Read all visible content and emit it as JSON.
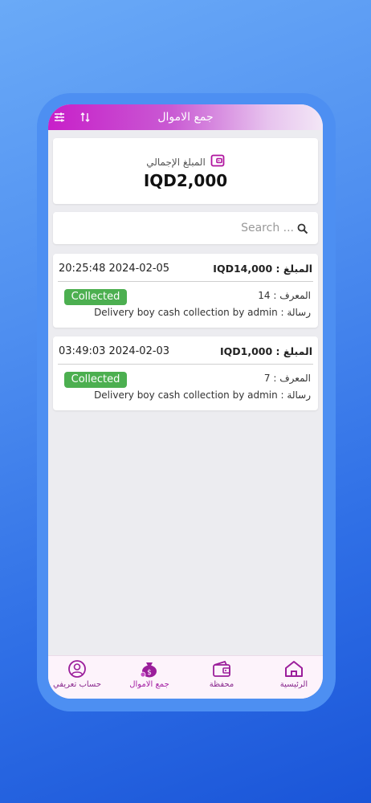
{
  "header": {
    "title": "جمع الاموال"
  },
  "total": {
    "label": "المبلغ الإجمالي",
    "value": "IQD2,000"
  },
  "search": {
    "placeholder": "Search ..."
  },
  "transactions": [
    {
      "amount_label": "المبلغ :",
      "amount": "IQD14,000",
      "datetime": "2024-02-05 20:25:48",
      "status": "Collected",
      "id_label": "المعرف :",
      "id": "14",
      "message_label": "رسالة :",
      "message": "Delivery boy cash collection by admin"
    },
    {
      "amount_label": "المبلغ :",
      "amount": "IQD1,000",
      "datetime": "2024-02-03 03:49:03",
      "status": "Collected",
      "id_label": "المعرف :",
      "id": "7",
      "message_label": "رسالة :",
      "message": "Delivery boy cash collection by admin"
    }
  ],
  "nav": {
    "home": "الرئيسية",
    "wallet": "محفظة",
    "collect": "جمع الاموال",
    "profile": "حساب تعريفي"
  },
  "colors": {
    "accent": "#c81fc9",
    "badge": "#4caf50",
    "nav_icon": "#9b1e9b"
  },
  "icons": {
    "filter": "sliders-icon",
    "sort": "sort-arrows-icon",
    "wallet": "wallet-icon",
    "search": "search-icon",
    "home": "home-icon",
    "collect": "money-bag-icon",
    "profile": "user-circle-icon"
  }
}
